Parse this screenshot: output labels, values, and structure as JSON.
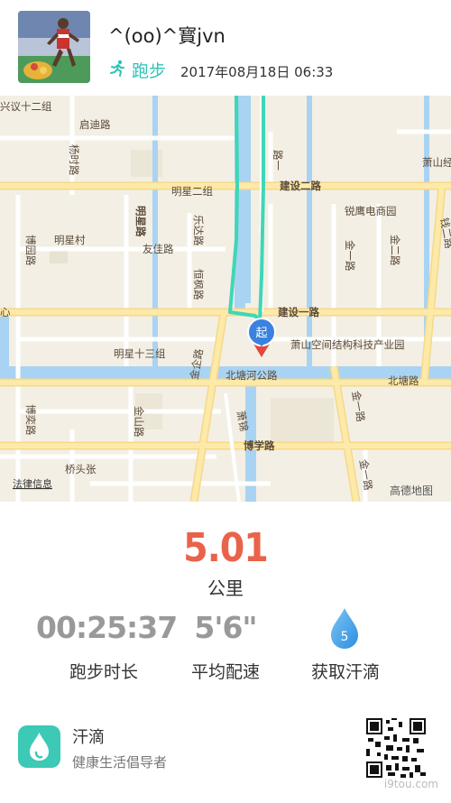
{
  "header": {
    "username": "^(oo)^寳jvn",
    "activity": "跑步",
    "datetime": "2017年08月18日 06:33"
  },
  "map": {
    "labels": {
      "xingyi": "兴议十二组",
      "qidi_road": "启迪路",
      "yangshi_road": "杨时路",
      "mingxing2": "明星二组",
      "jianshe2": "建设二路",
      "xiaoshan_shan": "萧山经",
      "ruiying": "锐鹰电商园",
      "jinyi_road": "金一路",
      "jiner_road": "金二路",
      "jinqi_road": "钱二路",
      "boyuan_road": "博园路",
      "mingxing_village": "明星村",
      "youjia_road": "友佳路",
      "mingxing_road": "明星路",
      "leda_road": "乐达路",
      "hengfeng_road": "恒枫路",
      "jianshe1": "建设一路",
      "xin": "心",
      "mingxing13": "明星十三组",
      "space_park": "萧山空间结构科技产业园",
      "beitang_gong_road": "北塘河公路",
      "beitang_road": "北塘路",
      "jinqi_road2": "金企路",
      "jinyi_road2": "金一路",
      "jinshan_road": "金山路",
      "boyi_road": "博奕路",
      "xiaoyi": "萧锦",
      "boxue_road": "博学路",
      "jinyi_road3": "金一路",
      "qiaotouzhang": "桥头张",
      "gaodu_one": "路一",
      "start_marker": "起",
      "legal": "法律信息",
      "provider": "高德地图"
    }
  },
  "stats": {
    "distance": "5.01",
    "distance_unit": "公里",
    "duration": "00:25:37",
    "duration_label": "跑步时长",
    "pace": "5'6\"",
    "pace_label": "平均配速",
    "drops": "5",
    "drops_label": "获取汗滴"
  },
  "footer": {
    "app_name": "汗滴",
    "slogan": "健康生活倡导者",
    "watermark": "i9tou.com"
  },
  "colors": {
    "accent": "#2ec4b6",
    "distance": "#e9634a",
    "route": "#3fd6b8",
    "water": "#a9d3f2",
    "road": "#fce8a6"
  }
}
